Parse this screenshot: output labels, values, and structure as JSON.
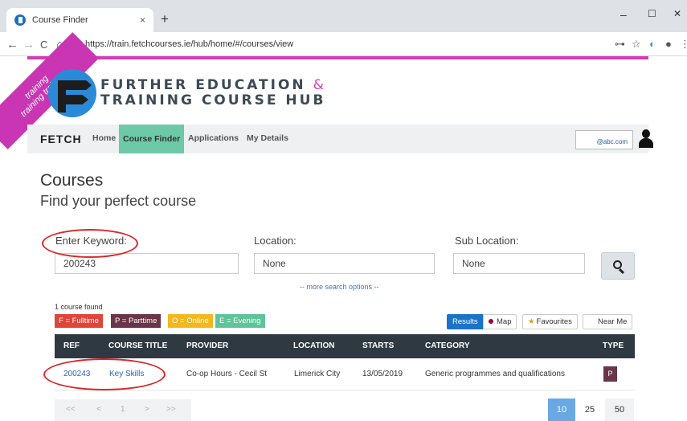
{
  "browser": {
    "tab_title": "Course Finder",
    "tab_close": "×",
    "new_tab": "+",
    "url": "https://train.fetchcourses.ie/hub/home/#/courses/view",
    "back": "←",
    "forward": "→",
    "reload": "C",
    "home": "⌂",
    "minimize": "–",
    "maximize": "☐",
    "close": "✕",
    "key_icon": "⊶",
    "star_icon": "☆",
    "menu_icon": "⋮"
  },
  "ribbon": {
    "line1": "training",
    "line2": "training training"
  },
  "brand": {
    "line1": "FURTHER EDUCATION",
    "amp": "&",
    "line2": "TRAINING COURSE HUB"
  },
  "nav": {
    "brand": "FETCH",
    "links": [
      "Home",
      "Course Finder",
      "Applications",
      "My Details"
    ],
    "user_email": "@abc.com"
  },
  "page": {
    "title": "Courses",
    "subtitle": "Find your perfect course"
  },
  "search": {
    "keyword_label": "Enter Keyword:",
    "keyword_value": "200243",
    "location_label": "Location:",
    "location_value": "None",
    "sublocation_label": "Sub Location:",
    "sublocation_value": "None",
    "more_options": "-- more search options --"
  },
  "results": {
    "count_text": "1 course found",
    "legend": [
      {
        "label": "F = Fulltime",
        "color": "#e0453a"
      },
      {
        "label": "P = Parttime",
        "color": "#6a3546"
      },
      {
        "label": "O = Online",
        "color": "#f2b81d"
      },
      {
        "label": "E = Evening",
        "color": "#5fc49b"
      }
    ],
    "view_buttons": [
      "Results",
      "Map",
      "Favourites",
      "Near Me"
    ],
    "columns": [
      "REF",
      "COURSE TITLE",
      "PROVIDER",
      "LOCATION",
      "STARTS",
      "CATEGORY",
      "TYPE"
    ],
    "rows": [
      {
        "ref": "200243",
        "title": "Key Skills",
        "provider": "Co-op Hours - Cecil St",
        "location": "Limerick City",
        "starts": "13/05/2019",
        "category": "Generic programmes and qualifications",
        "type": "P"
      }
    ]
  },
  "pagination": {
    "controls": [
      "<<",
      "<",
      "1",
      ">",
      ">>"
    ],
    "page_sizes": [
      "10",
      "25",
      "50"
    ],
    "active_page_size": "10"
  },
  "colors": {
    "accent_pink": "#d23db3",
    "nav_active": "#6dc9a7",
    "table_header": "#2f3942",
    "primary_blue": "#1a73c9",
    "annotation_red": "#d8282a"
  }
}
